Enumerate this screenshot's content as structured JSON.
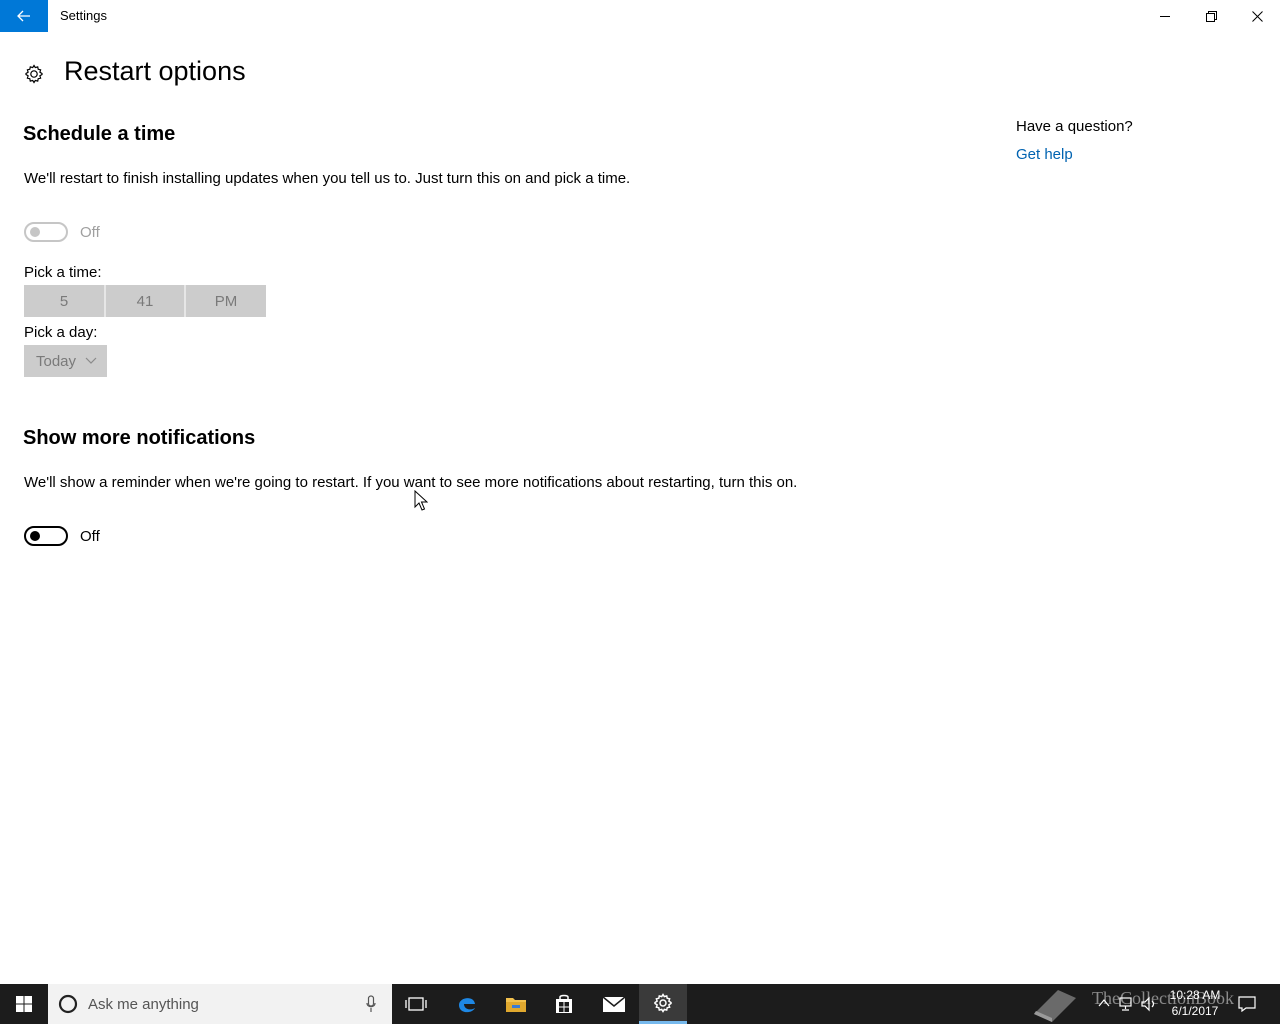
{
  "window": {
    "app_title": "Settings"
  },
  "page": {
    "title": "Restart options"
  },
  "schedule": {
    "heading": "Schedule a time",
    "description": "We'll restart to finish installing updates when you tell us to. Just turn this on and pick a time.",
    "toggle_state": "Off",
    "enabled": false,
    "time_label": "Pick a time:",
    "time_hour": "5",
    "time_minute": "41",
    "time_period": "PM",
    "day_label": "Pick a day:",
    "day_value": "Today"
  },
  "notifications": {
    "heading": "Show more notifications",
    "description": "We'll show a reminder when we're going to restart. If you want to see more notifications about restarting, turn this on.",
    "toggle_state": "Off"
  },
  "help": {
    "question": "Have a question?",
    "link": "Get help"
  },
  "taskbar": {
    "search_placeholder": "Ask me anything",
    "time": "10:28 AM",
    "date": "6/1/2017",
    "watermark": "TheCollectionBook"
  },
  "colors": {
    "accent": "#0078d7",
    "link": "#0063b1",
    "taskbar": "#1c1c1c",
    "disabled_fill": "#cccccc"
  },
  "icons": {
    "back": "back-arrow-icon",
    "page": "gear-icon",
    "minimize": "minimize-icon",
    "maximize": "restore-icon",
    "close": "close-icon"
  }
}
